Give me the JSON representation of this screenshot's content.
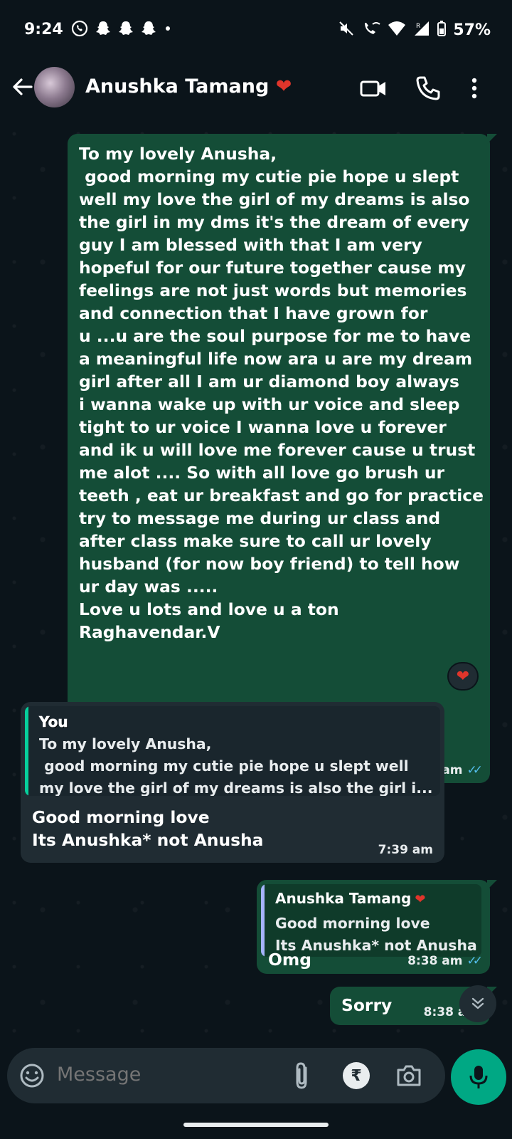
{
  "status_bar": {
    "time": "9:24",
    "battery": "57%",
    "left_icons": [
      "whatsapp-icon",
      "snapchat-icon",
      "snapchat-icon",
      "snapchat-icon",
      "dot"
    ],
    "right_icons": [
      "mute-icon",
      "wifi-call-icon",
      "wifi-icon",
      "signal-icon",
      "battery-icon"
    ]
  },
  "header": {
    "contact_name": "Anushka Tamang",
    "name_emoji": "❤",
    "icons": [
      "back-icon",
      "video-call-icon",
      "voice-call-icon",
      "more-options-icon"
    ]
  },
  "messages": [
    {
      "direction": "outgoing",
      "text": "To my lovely Anusha,\n good morning my cutie pie hope u slept\nwell my love the girl of my dreams is also\nthe girl in my dms it's the dream of every\nguy I am blessed with that I am very\nhopeful for our future together cause my\nfeelings are not just words but memories\nand connection that I have grown for\nu ...u are the soul purpose for me to have\na meaningful life now ara u are my dream\ngirl after all I am ur diamond boy always\ni wanna wake up with ur voice and sleep\ntight to ur voice I wanna love u forever\nand ik u will love me forever cause u trust\nme alot .... So with all love go brush ur\nteeth , eat ur breakfast and go for practice\ntry to message me during ur class and\nafter class make sure to call ur lovely\nhusband (for now boy friend) to tell how\nur day was .....\nLove u lots and love u a ton\nRaghavendar.V",
      "time": "12:24 am",
      "ticks": "✓✓",
      "reaction": "❤"
    },
    {
      "direction": "incoming",
      "quote_author": "You",
      "quote_text": "To my lovely Anusha,\n good morning my cutie pie hope u slept well\nmy love the girl of my dreams is also the girl i...",
      "text": "Good morning love\nIts Anushka* not Anusha",
      "time": "7:39 am"
    },
    {
      "direction": "outgoing",
      "quote_author": "Anushka Tamang",
      "quote_author_emoji": "❤",
      "quote_text": "Good morning love\nIts Anushka* not Anusha",
      "text": "Omg",
      "time": "8:38 am",
      "ticks": "✓✓"
    },
    {
      "direction": "outgoing",
      "text": "Sorry",
      "time": "8:38 am"
    }
  ],
  "composer": {
    "placeholder": "Message",
    "icons": [
      "emoji-icon",
      "attach-icon",
      "rupee-payment-icon",
      "camera-icon",
      "mic-icon"
    ],
    "rupee_symbol": "₹"
  },
  "colors": {
    "background": "#0b141a",
    "outgoing_bubble": "#144d37",
    "incoming_bubble": "#202c33",
    "read_ticks": "#53bdeb",
    "accent_green": "#00a884",
    "you_quote_bar": "#06cf9c",
    "contact_quote_bar": "#a5b4fc"
  }
}
